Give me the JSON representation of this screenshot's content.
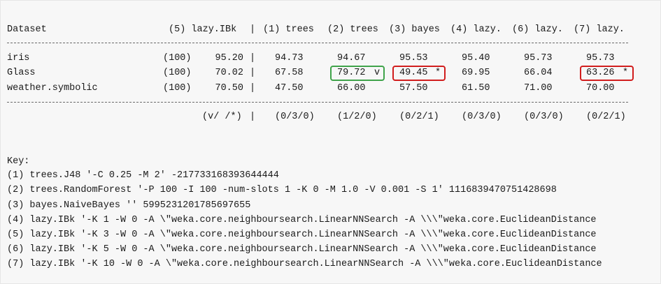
{
  "colors": {
    "highlight_better": "#3fa34a",
    "highlight_worse": "#d11d1d"
  },
  "header": {
    "dataset_label": "Dataset",
    "baseline": "(5) lazy.IBk",
    "pipe": "|",
    "columns": [
      "(1) trees",
      "(2) trees",
      "(3) bayes",
      "(4) lazy.",
      "(6) lazy.",
      "(7) lazy."
    ]
  },
  "rows": [
    {
      "dataset": "iris",
      "count": "(100)",
      "baseline": "95.20",
      "pipe": "|",
      "values": [
        "94.73",
        "94.67",
        "95.53",
        "95.40",
        "95.73",
        "95.73"
      ],
      "marks": [
        "",
        "",
        "",
        "",
        "",
        ""
      ]
    },
    {
      "dataset": "Glass",
      "count": "(100)",
      "baseline": "70.02",
      "pipe": "|",
      "values": [
        "67.58",
        "79.72",
        "49.45",
        "69.95",
        "66.04",
        "63.26"
      ],
      "marks": [
        "",
        "v",
        "*",
        "",
        "",
        "*"
      ]
    },
    {
      "dataset": "weather.symbolic",
      "count": "(100)",
      "baseline": "70.50",
      "pipe": "|",
      "values": [
        "47.50",
        "66.00",
        "57.50",
        "61.50",
        "71.00",
        "70.00"
      ],
      "marks": [
        "",
        "",
        "",
        "",
        "",
        ""
      ]
    }
  ],
  "summary": {
    "label": "(v/ /*)",
    "pipe": "|",
    "values": [
      "(0/3/0)",
      "(1/2/0)",
      "(0/2/1)",
      "(0/3/0)",
      "(0/3/0)",
      "(0/2/1)"
    ]
  },
  "key": {
    "title": "Key:",
    "lines": [
      "(1) trees.J48 '-C 0.25 -M 2' -217733168393644444",
      "(2) trees.RandomForest '-P 100 -I 100 -num-slots 1 -K 0 -M 1.0 -V 0.001 -S 1' 1116839470751428698",
      "(3) bayes.NaiveBayes '' 5995231201785697655",
      "(4) lazy.IBk '-K 1 -W 0 -A \\\"weka.core.neighboursearch.LinearNNSearch -A \\\\\\\"weka.core.EuclideanDistance",
      "(5) lazy.IBk '-K 3 -W 0 -A \\\"weka.core.neighboursearch.LinearNNSearch -A \\\\\\\"weka.core.EuclideanDistance",
      "(6) lazy.IBk '-K 5 -W 0 -A \\\"weka.core.neighboursearch.LinearNNSearch -A \\\\\\\"weka.core.EuclideanDistance",
      "(7) lazy.IBk '-K 10 -W 0 -A \\\"weka.core.neighboursearch.LinearNNSearch -A \\\\\\\"weka.core.EuclideanDistance"
    ]
  }
}
